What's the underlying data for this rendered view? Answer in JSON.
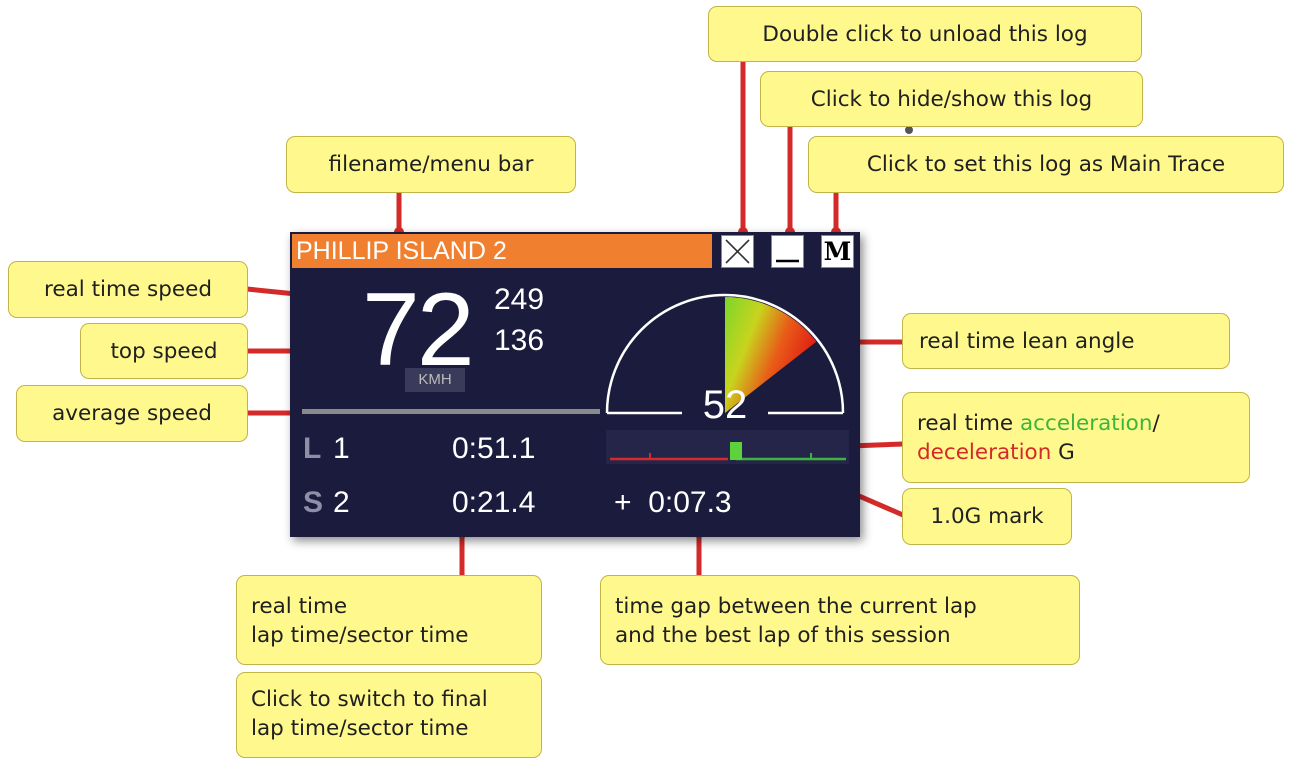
{
  "widget": {
    "title": "PHILLIP ISLAND 2",
    "buttons": {
      "close": "close-x",
      "hide": "minimize",
      "main": "M"
    },
    "speed": "72",
    "top_speed": "249",
    "avg_speed": "136",
    "unit": "KMH",
    "speed_bar_fraction": 1.0,
    "lean_angle": "52",
    "lean_value": 52,
    "lap": {
      "letter": "L",
      "number": "1",
      "time": "0:51.1"
    },
    "sector": {
      "letter": "S",
      "number": "2",
      "time": "0:21.4"
    },
    "gap": "+  0:07.3",
    "g_meter": {
      "decel_fraction": 0.55,
      "accel_fraction": 0.55
    },
    "colors": {
      "title_bg": "#f08030",
      "panel_bg": "#1b1b3d",
      "accel": "#3cb53c",
      "decel": "#d42a2a",
      "callout_bg": "#fff98d",
      "leader": "#d42a2a"
    }
  },
  "callouts": {
    "unload": "Double click to unload this log",
    "hide_show": "Click to hide/show this log",
    "main_trace": "Click to set this log as Main Trace",
    "filename": "filename/menu bar",
    "realtime_speed": "real time speed",
    "top_speed": "top speed",
    "avg_speed": "average speed",
    "lean_angle": "real time lean angle",
    "accel_prefix": "real time ",
    "accel_word": "acceleration",
    "accel_slash": "/",
    "decel_word": "deceleration",
    "decel_suffix": " G",
    "g_mark": "1.0G mark",
    "laptime_line1": "real time",
    "laptime_line2": "lap time/sector time",
    "gap_line1": "time gap between the current lap",
    "gap_line2": "and the best lap of this session",
    "switch_line1": "Click to switch to final",
    "switch_line2": "lap time/sector time"
  }
}
